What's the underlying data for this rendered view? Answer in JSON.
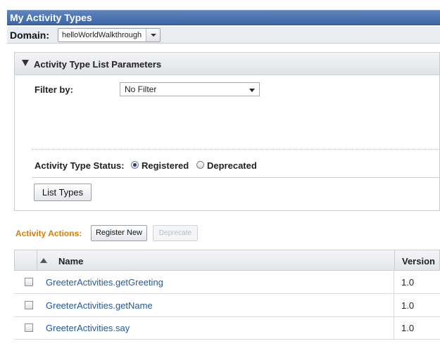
{
  "window": {
    "title": "My Activity Types"
  },
  "domain": {
    "label": "Domain:",
    "selected": "helloWorldWalkthrough"
  },
  "params": {
    "title": "Activity Type List Parameters",
    "filter_label": "Filter by:",
    "filter_selected": "No Filter",
    "status_label": "Activity Type Status:",
    "status_options": [
      {
        "label": "Registered",
        "checked": true
      },
      {
        "label": "Deprecated",
        "checked": false
      }
    ],
    "list_button": "List Types"
  },
  "actions": {
    "label": "Activity Actions:",
    "register_button": "Register New",
    "deprecate_button": "Deprecate"
  },
  "table": {
    "columns": [
      "Name",
      "Version"
    ],
    "rows": [
      {
        "name": "GreeterActivities.getGreeting",
        "version": "1.0"
      },
      {
        "name": "GreeterActivities.getName",
        "version": "1.0"
      },
      {
        "name": "GreeterActivities.say",
        "version": "1.0"
      }
    ]
  }
}
